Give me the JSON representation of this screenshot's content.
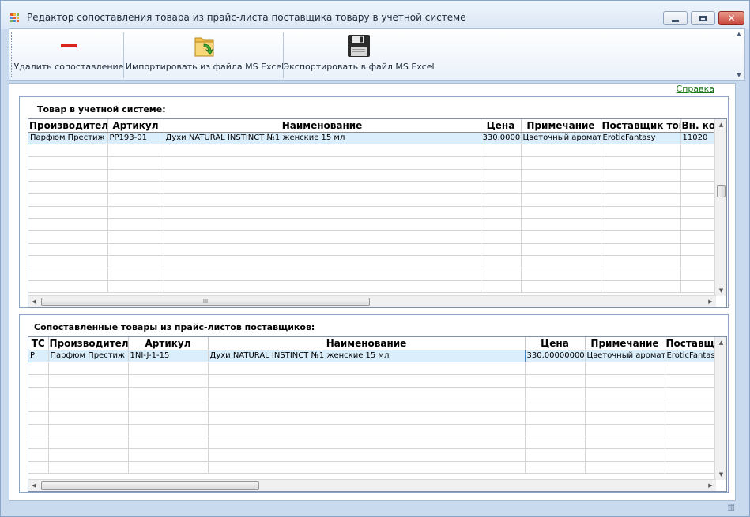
{
  "window": {
    "title": "Редактор сопоставления товара из прайс-листа поставщика товару в учетной системе",
    "colors": {
      "accent": "#c9d9ee",
      "close": "#c7443a",
      "selection": "#dbeefc",
      "link": "#1a7a1a"
    }
  },
  "toolbar": {
    "delete_label": "Удалить сопоставление",
    "import_label": "Импортировать из файла MS Excel",
    "export_label": "Экспортировать в файл MS Excel",
    "delete_icon": "minus-icon",
    "import_icon": "folder-import-icon",
    "export_icon": "floppy-disk-icon"
  },
  "help_link": "Справка",
  "accounting": {
    "title": "Товар в учетной системе:",
    "columns": [
      "Производитель",
      "Артикул",
      "Наименование",
      "Цена",
      "Примечание",
      "Поставщик товара",
      "Вн. код"
    ],
    "rows": [
      [
        "Парфюм Престиж",
        "PP193-01",
        "Духи NATURAL INSTINCT №1 женские 15 мл",
        "330.00000000",
        "Цветочный аромат",
        "EroticFantasy",
        "11020"
      ]
    ]
  },
  "matched": {
    "title": "Сопоставленные товары из прайс-листов поставщиков:",
    "columns": [
      "ТС",
      "Производитель",
      "Артикул",
      "Наименование",
      "Цена",
      "Примечание",
      "Поставщик"
    ],
    "rows": [
      [
        "Р",
        "Парфюм Престиж",
        "1NI-J-1-15",
        "Духи NATURAL INSTINCT №1  женские 15 мл",
        "330.00000000",
        "Цветочный аромат",
        "EroticFantasy"
      ]
    ]
  },
  "scroll_grip": "III"
}
